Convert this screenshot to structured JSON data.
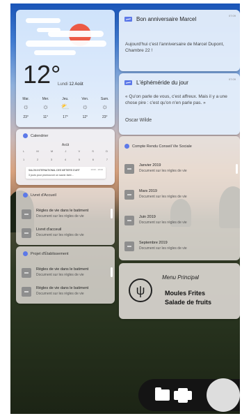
{
  "weather": {
    "temperature": "12°",
    "date_prefix": "Lundi",
    "date_value": "12 Août",
    "days": [
      {
        "name": "Mar.",
        "icon": "sun-icon",
        "temp": "23°"
      },
      {
        "name": "Mer.",
        "icon": "sun-icon",
        "temp": "11°"
      },
      {
        "name": "Jeu.",
        "icon": "cloud-sun-icon",
        "temp": "17°"
      },
      {
        "name": "Ven.",
        "icon": "sun-icon",
        "temp": "12°"
      },
      {
        "name": "Sam.",
        "icon": "sun-icon",
        "temp": "23°"
      }
    ]
  },
  "calendar": {
    "title": "Calendrier",
    "month": "Août",
    "weekdays": [
      "L",
      "M",
      "M",
      "J",
      "V",
      "S",
      "D"
    ],
    "week_dates": [
      "1",
      "2",
      "3",
      "4",
      "5",
      "6",
      "7"
    ],
    "event": {
      "title": "SALON INTERNATIONAL DES METIERS D'ART",
      "subtitle": "3 jours pour promouvoir un savoir-faire...",
      "time": "10:00 - 18:00"
    }
  },
  "livret": {
    "title": "Livret d'Accueil",
    "items": [
      {
        "title": "Règles de vie dans le batiment",
        "subtitle": "Document sur les règles de vie"
      },
      {
        "title": "Livret d'acceuil",
        "subtitle": "Document sur les règles de vie"
      }
    ]
  },
  "projet": {
    "title": "Projet d'Établissement",
    "items": [
      {
        "title": "Règles de vie dans le batiment",
        "subtitle": "Document sur les règles de vie"
      },
      {
        "title": "Règles de vie dans le batiment",
        "subtitle": "Document sur les règles de vie"
      }
    ]
  },
  "notifications": {
    "anniversaire": {
      "title": "Bon anniversaire Marcel",
      "time": "07:09",
      "body": "Aujourd'hui c'est l'anniversaire de Marcel Dupont, Chambre 22 !"
    },
    "ephemeride": {
      "title": "L'éphéméride du jour",
      "time": "07:09",
      "body": "« Qu'on parle de vous, c'est affreux. Mais il y a une chose pire : c'est qu'on n'en parle pas. »",
      "author": "Oscar Wilde"
    }
  },
  "compte_rendu": {
    "title": "Compte Rendu Conseil Vie Sociale",
    "items": [
      {
        "title": "Janvier 2019",
        "subtitle": "Document sur les règles de vie"
      },
      {
        "title": "Mars 2019",
        "subtitle": "Document sur les règles de vie"
      },
      {
        "title": "Juin 2019",
        "subtitle": "Document sur les règles de vie"
      },
      {
        "title": "Septembre 2019",
        "subtitle": "Document sur les règles de vie"
      }
    ]
  },
  "menu": {
    "title": "Menu Principal",
    "line1": "Moules Frites",
    "line2": "Salade de fruits",
    "icon": "fork-knife-icon"
  },
  "dock": {
    "items": [
      "folder-icon",
      "cards-icon",
      "home-circle-button"
    ]
  }
}
